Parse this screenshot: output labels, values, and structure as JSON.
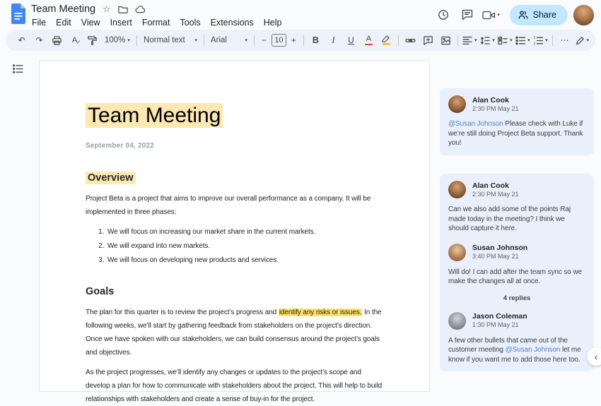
{
  "header": {
    "doc_title": "Team Meeting",
    "menus": [
      "File",
      "Edit",
      "View",
      "Insert",
      "Format",
      "Tools",
      "Extensions",
      "Help"
    ],
    "share_label": "Share"
  },
  "toolbar": {
    "zoom": "100%",
    "style": "Normal text",
    "font": "Arial",
    "font_size": "10"
  },
  "icons": {
    "star": "☆",
    "undo": "↶",
    "redo": "↷",
    "caret": "▾",
    "minus": "−",
    "plus": "+",
    "bold": "B",
    "italic": "I",
    "underline": "U",
    "text_color": "A",
    "spellcheck_letter": "A",
    "spellcheck_check": "✓",
    "more": "⋯",
    "collapse": "∧",
    "chevron_left": "‹"
  },
  "document": {
    "title": "Team Meeting",
    "date": "September 04, 2022",
    "overview_heading": "Overview",
    "overview_intro": "Project Beta is a project that aims to improve our overall performance as a company. It will be implemented in three phases:",
    "phases": [
      "We will focus on increasing our market share in the current markets.",
      "We will expand into new markets.",
      "We will focus on developing new products and services."
    ],
    "goals_heading": "Goals",
    "goals_p1_before": "The plan for this quarter is to review the project’s progress and ",
    "goals_p1_highlight": "identify any risks or issues.",
    "goals_p1_after": " In the following weeks, we’ll start by gathering feedback from stakeholders on the project’s direction. Once we have spoken with our stakeholders, we can build consensus around the project’s goals and objectives.",
    "goals_p2": "As the project progresses, we’ll identify any changes or updates to the project’s scope and develop a plan for how to communicate with stakeholders about the project. This will help to build relationships with stakeholders and create a sense of buy-in for the project."
  },
  "comments": {
    "card1": {
      "author": "Alan Cook",
      "time": "2:30 PM May 21",
      "mention": "@Susan Johnson",
      "text": " Please check with Luke if we’re still doing Project Beta support. Thank you!"
    },
    "thread": {
      "replies_label": "4 replies",
      "items": [
        {
          "author": "Alan Cook",
          "time": "2:30 PM May 21",
          "text_before": "Can we also add some of the points Raj made today in the meeting? I think we should capture it here.",
          "mention": "",
          "text_after": ""
        },
        {
          "author": "Susan Johnson",
          "time": "3:40 PM May 21",
          "text_before": "Will do! I can add after the team sync so we make the changes all at once.",
          "mention": "",
          "text_after": ""
        },
        {
          "author": "Jason Coleman",
          "time": "1:30 PM May 21",
          "text_before": "A few other bullets that came out of the customer meeting ",
          "mention": "@Susan Johnson",
          "text_after": " let me know if you want me to add those here too."
        }
      ]
    }
  },
  "colors": {
    "share_button_bg": "#c2e7ff",
    "share_button_text": "#001d35",
    "title_highlight": "#fce8b2",
    "inline_highlight": "#ffe168",
    "comment_card_bg": "#e9f0fb",
    "mention_link": "#5a7fc6",
    "docs_logo_blue": "#4285f4",
    "toolbar_bg": "#edf2fa"
  }
}
